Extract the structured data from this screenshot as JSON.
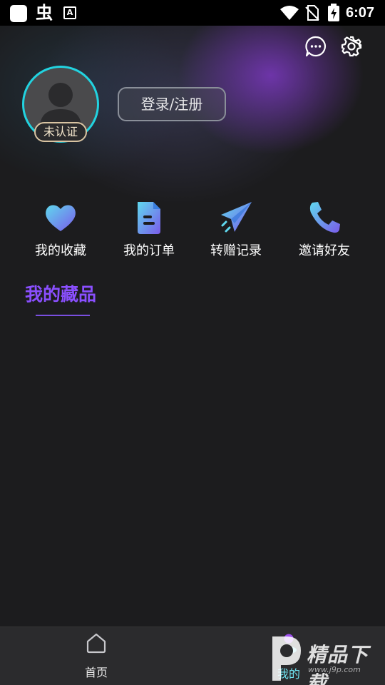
{
  "status_bar": {
    "app_glyph": "虫",
    "a_icon": "A",
    "time": "6:07"
  },
  "header": {
    "message_icon": "chat-bubble-icon",
    "settings_icon": "gear-icon",
    "verify_badge": "未认证",
    "login_button": "登录/注册"
  },
  "quick_actions": [
    {
      "label": "我的收藏",
      "icon": "heart-icon"
    },
    {
      "label": "我的订单",
      "icon": "document-icon"
    },
    {
      "label": "转赠记录",
      "icon": "paper-plane-icon"
    },
    {
      "label": "邀请好友",
      "icon": "phone-icon"
    }
  ],
  "section": {
    "title": "我的藏品"
  },
  "bottom_nav": {
    "items": [
      {
        "label": "首页",
        "icon": "home-icon",
        "active": false
      },
      {
        "label": "我的",
        "icon": "profile-icon",
        "active": true
      }
    ]
  },
  "watermark": {
    "text": "精品下载",
    "url": "www.j9p.com"
  },
  "colors": {
    "accent_purple": "#8a4fff",
    "avatar_ring": "#22d3e0",
    "background": "#1c1c1e"
  }
}
